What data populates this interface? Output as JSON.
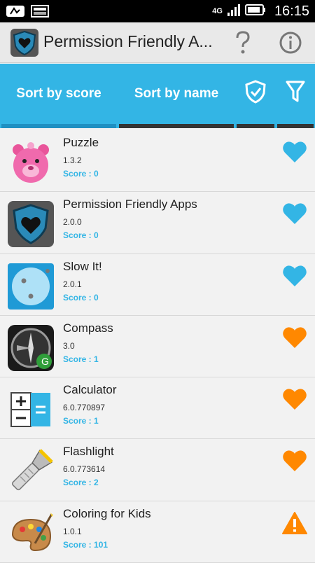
{
  "status_bar": {
    "network": "4G",
    "time": "16:15"
  },
  "action_bar": {
    "title": "Permission Friendly A..."
  },
  "tabs": [
    {
      "label": "Sort by score"
    },
    {
      "label": "Sort by name"
    }
  ],
  "apps": [
    {
      "name": "Puzzle",
      "version": "1.3.2",
      "score": "Score : 0",
      "status_icon": "heart-blue-icon"
    },
    {
      "name": "Permission Friendly Apps",
      "version": "2.0.0",
      "score": "Score : 0",
      "status_icon": "heart-blue-icon"
    },
    {
      "name": "Slow It!",
      "version": "2.0.1",
      "score": "Score : 0",
      "status_icon": "heart-blue-icon"
    },
    {
      "name": "Compass",
      "version": "3.0",
      "score": "Score : 1",
      "status_icon": "heart-orange-icon"
    },
    {
      "name": "Calculator",
      "version": "6.0.770897",
      "score": "Score : 1",
      "status_icon": "heart-orange-icon"
    },
    {
      "name": "Flashlight",
      "version": "6.0.773614",
      "score": "Score : 2",
      "status_icon": "heart-orange-icon"
    },
    {
      "name": "Coloring for Kids",
      "version": "1.0.1",
      "score": "Score : 101",
      "status_icon": "warning-icon"
    }
  ],
  "colors": {
    "accent": "#33b5e5",
    "heart_blue": "#33b5e5",
    "heart_orange": "#ff8800",
    "warning": "#ff8800"
  }
}
